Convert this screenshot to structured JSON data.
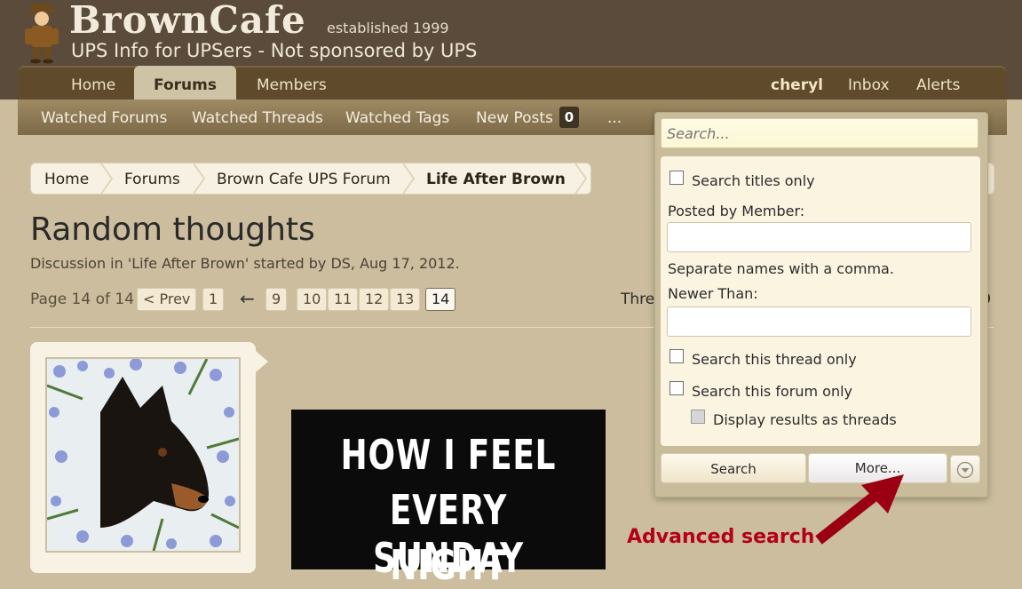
{
  "header": {
    "logo": "BrownCafe",
    "established": "established 1999",
    "tagline": "UPS Info for UPSers - Not sponsored by UPS"
  },
  "nav": {
    "home": "Home",
    "forums": "Forums",
    "members": "Members",
    "user": "cheryl",
    "inbox": "Inbox",
    "alerts": "Alerts"
  },
  "subnav": {
    "watched_forums": "Watched Forums",
    "watched_threads": "Watched Threads",
    "watched_tags": "Watched Tags",
    "new_posts": "New Posts",
    "new_posts_count": "0",
    "more": "..."
  },
  "breadcrumb": {
    "items": [
      "Home",
      "Forums",
      "Brown Cafe UPS Forum",
      "Life After Brown"
    ]
  },
  "thread": {
    "title": "Random thoughts",
    "subtitle": "Discussion in 'Life After Brown' started by DS, Aug 17, 2012.",
    "tools_partial": "Thre",
    "right_partial": "0"
  },
  "pager": {
    "label": "Page 14 of 14",
    "prev": "< Prev",
    "first": "1",
    "arrow": "←",
    "pages": [
      "9",
      "10",
      "11",
      "12",
      "13"
    ],
    "current": "14"
  },
  "meme": {
    "lines": [
      "HOW I FEEL",
      "EVERY SUNDAY",
      "NIGHT"
    ]
  },
  "search": {
    "placeholder": "Search...",
    "titles_only": "Search titles only",
    "posted_by_label": "Posted by Member:",
    "names_hint": "Separate names with a comma.",
    "newer_than_label": "Newer Than:",
    "thread_only": "Search this thread only",
    "forum_only": "Search this forum only",
    "display_threads": "Display results as threads",
    "search_button": "Search",
    "more_button": "More..."
  },
  "annotation": {
    "label": "Advanced search"
  },
  "colors": {
    "header_bg": "#5a4b3b",
    "page_bg": "#cbbd9d",
    "nav_bg": "#5f4a2c",
    "accent_red": "#b3001a"
  }
}
